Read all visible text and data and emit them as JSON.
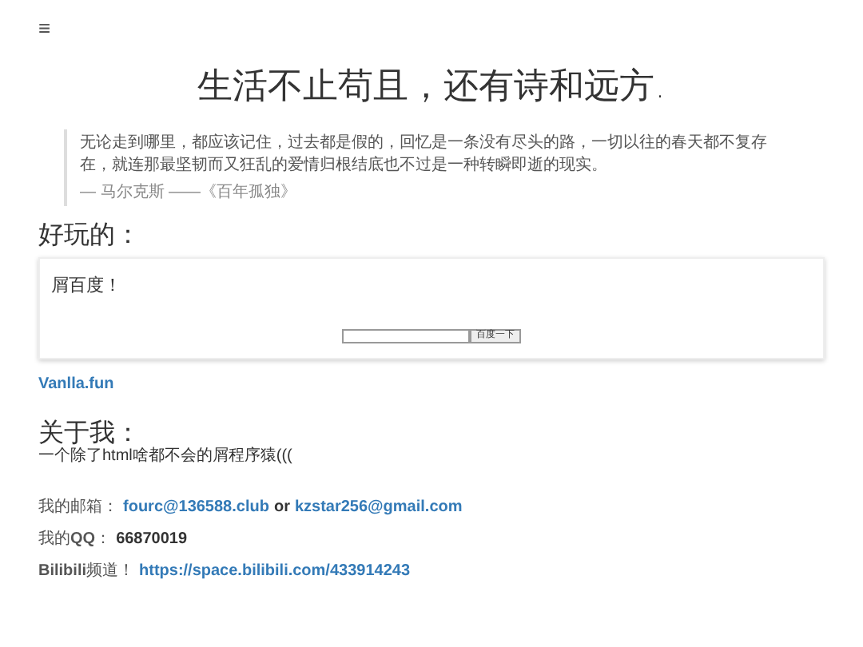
{
  "menu_icon": "≡",
  "title": "生活不止苟且，还有诗和远方.",
  "quote": {
    "text": "无论走到哪里，都应该记住，过去都是假的，回忆是一条没有尽头的路，一切以往的春天都不复存在，就连那最坚韧而又狂乱的爱情归根结底也不过是一种转瞬即逝的现实。",
    "source": "— 马尔克斯 ——《百年孤独》"
  },
  "fun": {
    "heading": "好玩的：",
    "card_text": "屑百度！",
    "search_button": "百度一下",
    "link": "Vanlla.fun"
  },
  "about": {
    "heading": "关于我：",
    "bio": "一个除了html啥都不会的屑程序猿((("
  },
  "email": {
    "label": "我的邮箱：",
    "links": [
      "fourc@136588.club",
      "kzstar256@gmail.com"
    ],
    "joiner": "or"
  },
  "qq": {
    "label": "我的**QQ**：",
    "value": "66870019"
  },
  "bilibili": {
    "label": "**Bilibili**频道！",
    "link": "https://space.bilibili.com/433914243"
  }
}
